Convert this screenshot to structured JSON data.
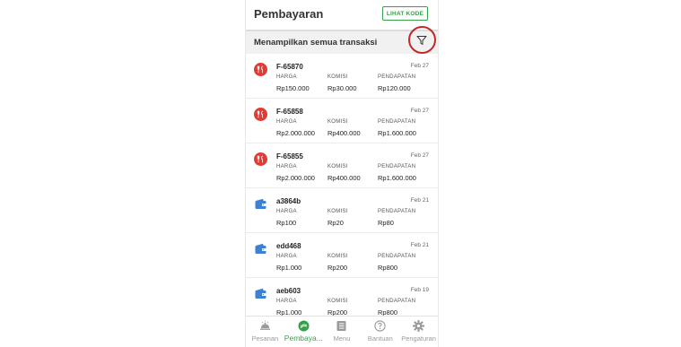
{
  "header": {
    "title": "Pembayaran",
    "code_button": "LIHAT KODE"
  },
  "filter": {
    "label": "Menampilkan semua transaksi",
    "icon": "filter-icon"
  },
  "columns": {
    "price": "HARGA",
    "commission": "KOMISI",
    "income": "PENDAPATAN"
  },
  "transactions": [
    {
      "id": "F-65870",
      "date": "Feb 27",
      "icon": "food-icon",
      "price": "Rp150.000",
      "commission": "Rp30.000",
      "income": "Rp120.000"
    },
    {
      "id": "F-65858",
      "date": "Feb 27",
      "icon": "food-icon",
      "price": "Rp2.000.000",
      "commission": "Rp400.000",
      "income": "Rp1.600.000"
    },
    {
      "id": "F-65855",
      "date": "Feb 27",
      "icon": "food-icon",
      "price": "Rp2.000.000",
      "commission": "Rp400.000",
      "income": "Rp1.600.000"
    },
    {
      "id": "a3864b",
      "date": "Feb 21",
      "icon": "wallet-icon",
      "price": "Rp100",
      "commission": "Rp20",
      "income": "Rp80"
    },
    {
      "id": "edd468",
      "date": "Feb 21",
      "icon": "wallet-icon",
      "price": "Rp1.000",
      "commission": "Rp200",
      "income": "Rp800"
    },
    {
      "id": "aeb603",
      "date": "Feb 19",
      "icon": "wallet-icon",
      "price": "Rp1.000",
      "commission": "Rp200",
      "income": "Rp800"
    }
  ],
  "nav": [
    {
      "label": "Pesanan",
      "icon": "orders-icon"
    },
    {
      "label": "Pembaya...",
      "icon": "payment-icon",
      "active": true
    },
    {
      "label": "Menu",
      "icon": "menu-icon"
    },
    {
      "label": "Bantuan",
      "icon": "help-icon"
    },
    {
      "label": "Pengaturan",
      "icon": "settings-icon"
    }
  ],
  "colors": {
    "accent": "#36a148",
    "highlight_ring": "#c62828",
    "food_badge": "#e53935",
    "wallet": "#3b82d6"
  }
}
